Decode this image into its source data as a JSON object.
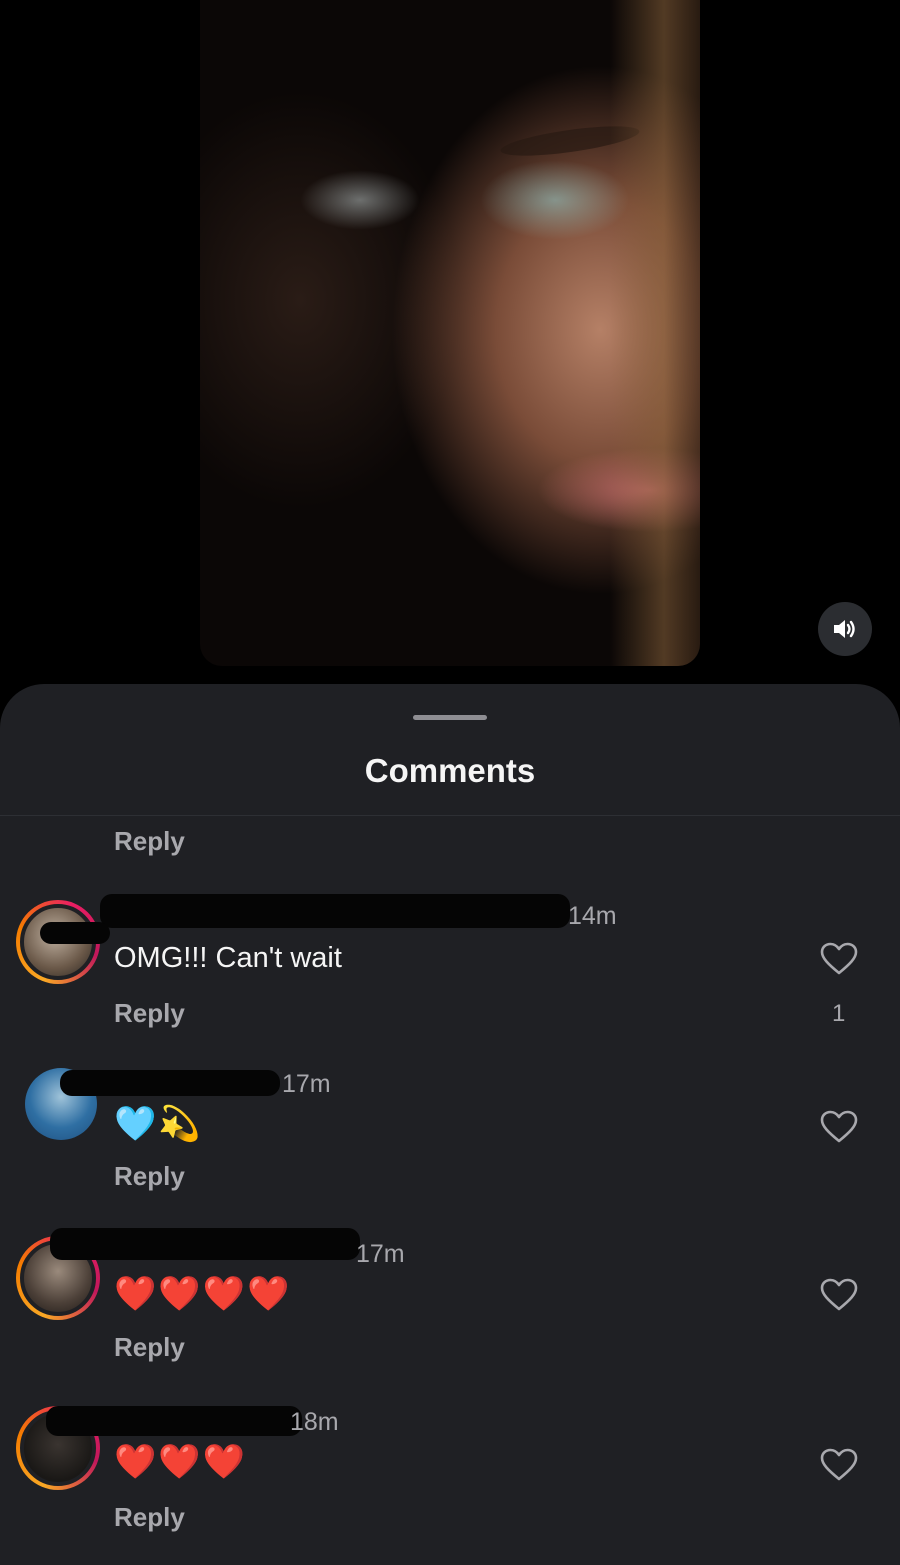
{
  "sheet": {
    "title": "Comments"
  },
  "top_reply": {
    "label": "Reply"
  },
  "comments": [
    {
      "time": "14m",
      "text": "OMG!!! Can't wait",
      "reply": "Reply",
      "likes": "1"
    },
    {
      "time": "17m",
      "text": "🩵💫",
      "reply": "Reply"
    },
    {
      "time": "17m",
      "text": "❤️❤️❤️❤️",
      "reply": "Reply"
    },
    {
      "time": "18m",
      "text": "❤️❤️❤️",
      "reply": "Reply"
    }
  ],
  "icons": {
    "sound": "speaker-icon",
    "like": "heart-outline-icon"
  },
  "colors": {
    "sheet_bg": "#1f2024",
    "text_primary": "#f5f5f5",
    "text_secondary": "#a8a8ad"
  }
}
